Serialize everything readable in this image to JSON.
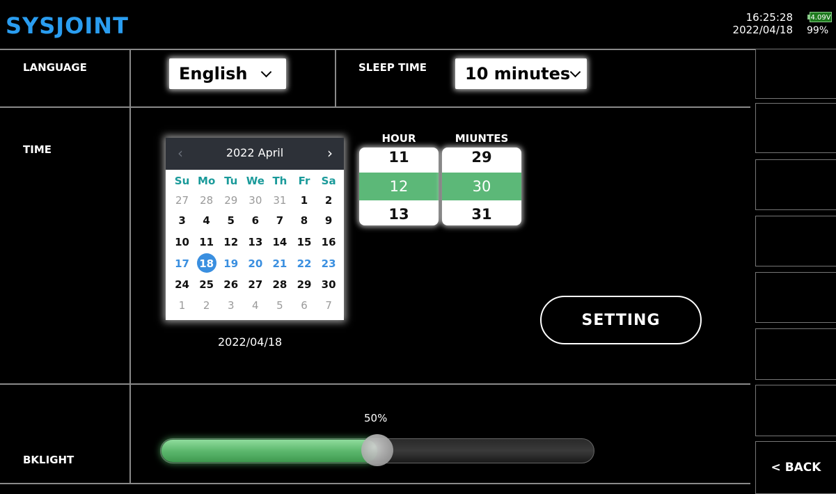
{
  "header": {
    "logo": "SYSJOINT",
    "time": "16:25:28",
    "date": "2022/04/18",
    "battery_voltage": "4.09V",
    "battery_percent": "99%"
  },
  "language": {
    "label": "LANGUAGE",
    "value": "English"
  },
  "sleep_time": {
    "label": "SLEEP TIME",
    "value": "10 minutes"
  },
  "time": {
    "label": "TIME",
    "calendar": {
      "title": "2022 April",
      "weekdays": [
        "Su",
        "Mo",
        "Tu",
        "We",
        "Th",
        "Fr",
        "Sa"
      ],
      "weeks": [
        [
          "27",
          "28",
          "29",
          "30",
          "31",
          "1",
          "2"
        ],
        [
          "3",
          "4",
          "5",
          "6",
          "7",
          "8",
          "9"
        ],
        [
          "10",
          "11",
          "12",
          "13",
          "14",
          "15",
          "16"
        ],
        [
          "17",
          "18",
          "19",
          "20",
          "21",
          "22",
          "23"
        ],
        [
          "24",
          "25",
          "26",
          "27",
          "28",
          "29",
          "30"
        ],
        [
          "1",
          "2",
          "3",
          "4",
          "5",
          "6",
          "7"
        ]
      ],
      "selected_day": "18"
    },
    "selected_date": "2022/04/18",
    "hour": {
      "label": "HOUR",
      "prev": "11",
      "selected": "12",
      "next": "13"
    },
    "minutes": {
      "label": "MIUNTES",
      "prev": "29",
      "selected": "30",
      "next": "31"
    },
    "setting_button": "SETTING"
  },
  "backlight": {
    "label": "BKLIGHT",
    "value_text": "50%",
    "value": 0.5
  },
  "side": {
    "back_label": "< BACK"
  },
  "colors": {
    "logo": "#2a9df0",
    "accent_green": "#5cb878",
    "selected_blue": "#3a8fe0"
  }
}
